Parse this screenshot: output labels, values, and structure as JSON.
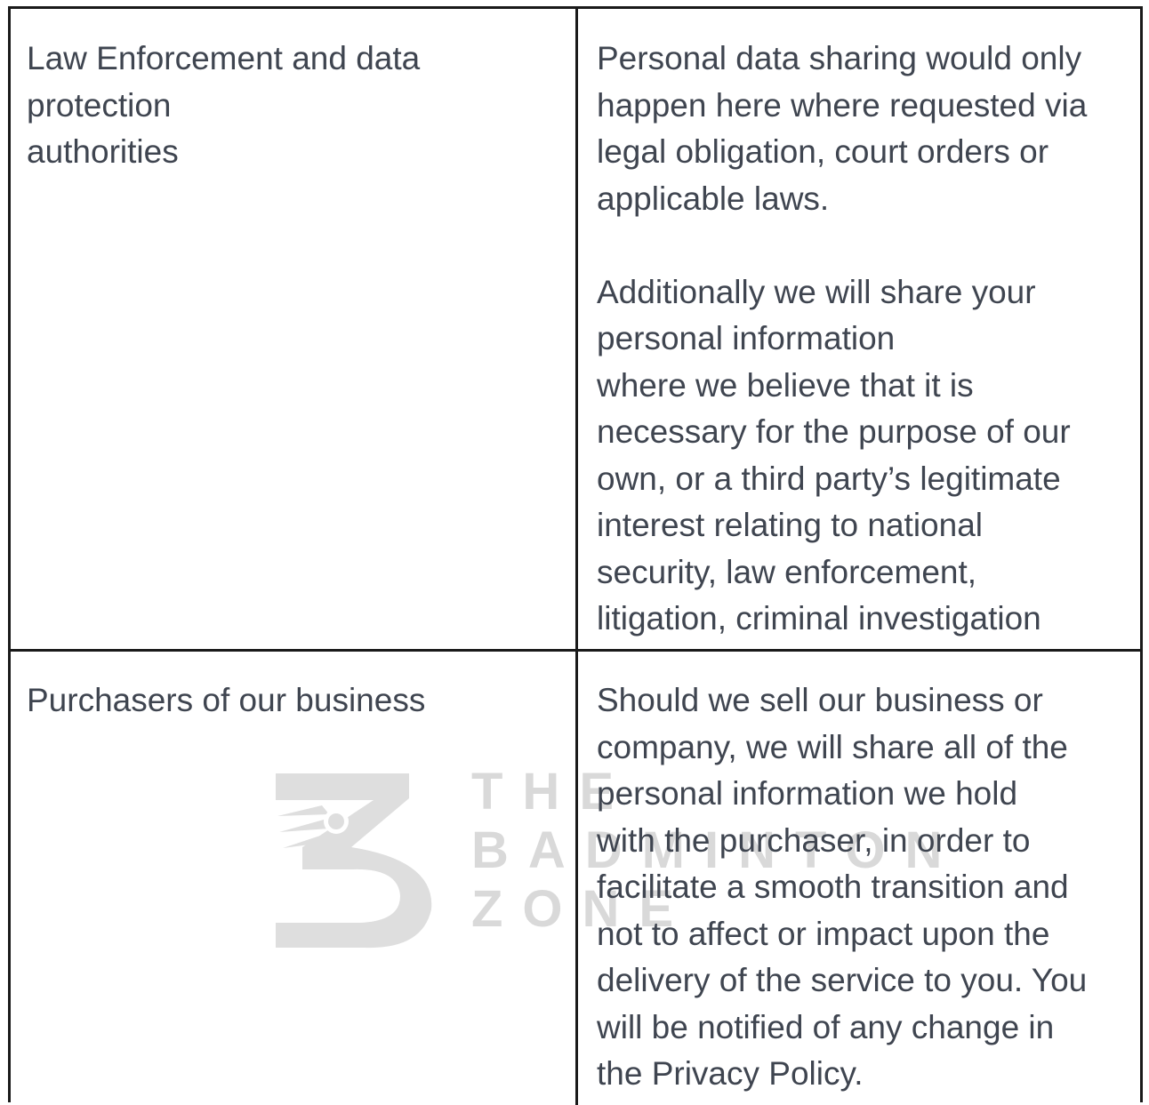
{
  "table": {
    "rows": [
      {
        "recipient": "Law Enforcement and data\nprotection\nauthorities",
        "description": "Personal data sharing would only\nhappen here where requested via\nlegal obligation, court orders or\napplicable laws.\n\nAdditionally we will share your\npersonal information\nwhere we believe that it is\nnecessary for the purpose of our\nown, or a third party’s legitimate\ninterest relating to national\nsecurity, law enforcement,\nlitigation, criminal investigation"
      },
      {
        "recipient": "Purchasers of our business",
        "description": "Should we sell our business or\ncompany, we will share all of the\npersonal information we hold\nwith the purchaser, in order to\nfacilitate a smooth transition and\nnot to affect or impact upon the\ndelivery of the service to you. You\nwill be notified of any change in\nthe Privacy Policy."
      }
    ]
  },
  "watermark": {
    "line1": "THE",
    "line2": "BADMINTON",
    "line3": "ZONE",
    "icon": "badminton-zone-logo-icon"
  },
  "colors": {
    "text": "#3f4550",
    "border": "#1a1a1a",
    "watermark": "#d9d9d9"
  }
}
